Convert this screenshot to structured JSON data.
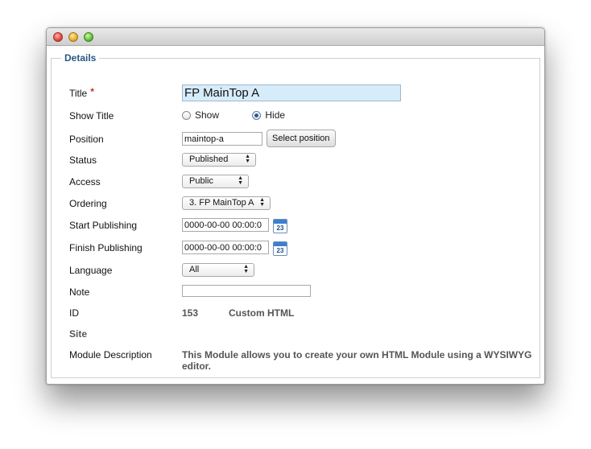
{
  "form": {
    "legend": "Details",
    "title": {
      "label": "Title",
      "required_mark": "*",
      "value": "FP MainTop A"
    },
    "show_title": {
      "label": "Show Title",
      "options": [
        "Show",
        "Hide"
      ],
      "selected": "Hide"
    },
    "position": {
      "label": "Position",
      "value": "maintop-a",
      "button": "Select position"
    },
    "status": {
      "label": "Status",
      "value": "Published"
    },
    "access": {
      "label": "Access",
      "value": "Public"
    },
    "ordering": {
      "label": "Ordering",
      "value": "3. FP MainTop A"
    },
    "start_publishing": {
      "label": "Start Publishing",
      "value": "0000-00-00 00:00:0",
      "calendar_day": "23"
    },
    "finish_publishing": {
      "label": "Finish Publishing",
      "value": "0000-00-00 00:00:0",
      "calendar_day": "23"
    },
    "language": {
      "label": "Language",
      "value": "All"
    },
    "note": {
      "label": "Note",
      "value": ""
    },
    "id": {
      "label": "ID",
      "value": "153",
      "type": "Custom HTML"
    },
    "site": {
      "label": "Site"
    },
    "module_description": {
      "label": "Module Description",
      "value": "This Module allows you to create your own HTML Module using a WYSIWYG editor."
    }
  },
  "colors": {
    "legend": "#2b5783",
    "title_field_bg": "#d7ecfb",
    "required": "#c0332a"
  },
  "icons": {
    "traffic_lights": [
      "close",
      "minimize",
      "zoom"
    ],
    "calendar": "calendar-icon"
  }
}
